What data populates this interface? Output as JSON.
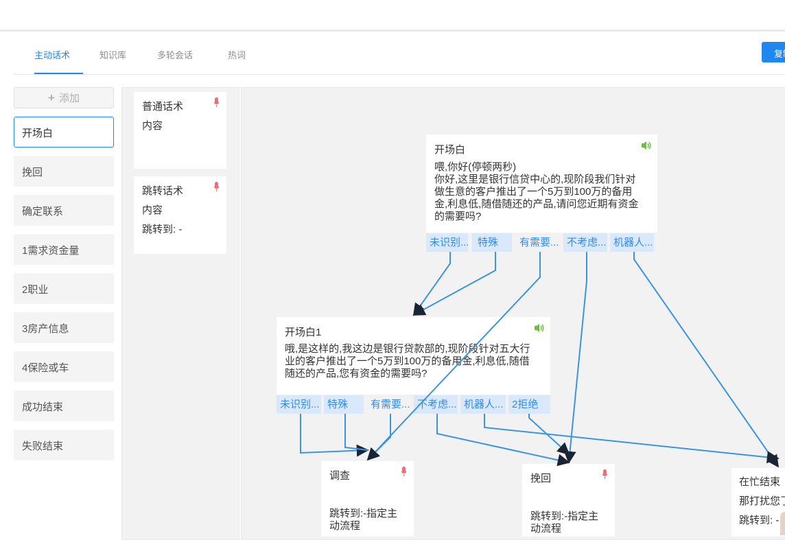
{
  "tabs": [
    "主动话术",
    "知识库",
    "多轮会话",
    "热词"
  ],
  "copy_button": "复制",
  "add_button": "添加",
  "nodes": [
    "开场白",
    "挽回",
    "确定联系",
    "1需求资金量",
    "2职业",
    "3房产信息",
    "4保险或车",
    "成功结束",
    "失败结束"
  ],
  "templates": {
    "normal": {
      "title": "普通话术",
      "content": "内容"
    },
    "jump": {
      "title": "跳转话术",
      "content": "内容",
      "jump": "跳转到: -"
    }
  },
  "flow": {
    "opening": {
      "title": "开场白",
      "line1": "喂,你好(停顿两秒)",
      "line2": "你好,这里是银行信贷中心的,现阶段我们针对",
      "line3": "做生意的客户推出了一个5万到100万的备用",
      "line4": "金,利息低,随借随还的产品,请问您近期有资金",
      "line5": "的需要吗?",
      "branches": [
        "未识别...",
        "特殊",
        "有需要...",
        "不考虑...",
        "机器人..."
      ]
    },
    "opening1": {
      "title": "开场白1",
      "line1": "哦,是这样的,我这边是银行贷款部的,现阶段针对五大行",
      "line2": "业的客户推出了一个5万到100万的备用金,利息低,随借",
      "line3": "随还的产品,您有资金的需要吗?",
      "branches": [
        "未识别...",
        "特殊",
        "有需要...",
        "不考虑...",
        "机器人...",
        "2拒绝"
      ]
    },
    "survey": {
      "title": "调查",
      "jump1": "跳转到:-指定主",
      "jump2": "动流程"
    },
    "retain": {
      "title": "挽回",
      "jump1": "跳转到:-指定主",
      "jump2": "动流程"
    },
    "busy_end": {
      "title": "在忙结束",
      "content": "那打扰您了",
      "jump": "跳转到: -"
    }
  },
  "colors": {
    "accent": "#1e87f0",
    "edge": "#3994e4",
    "mic": "#f56c6c",
    "speaker": "#67c23a"
  }
}
